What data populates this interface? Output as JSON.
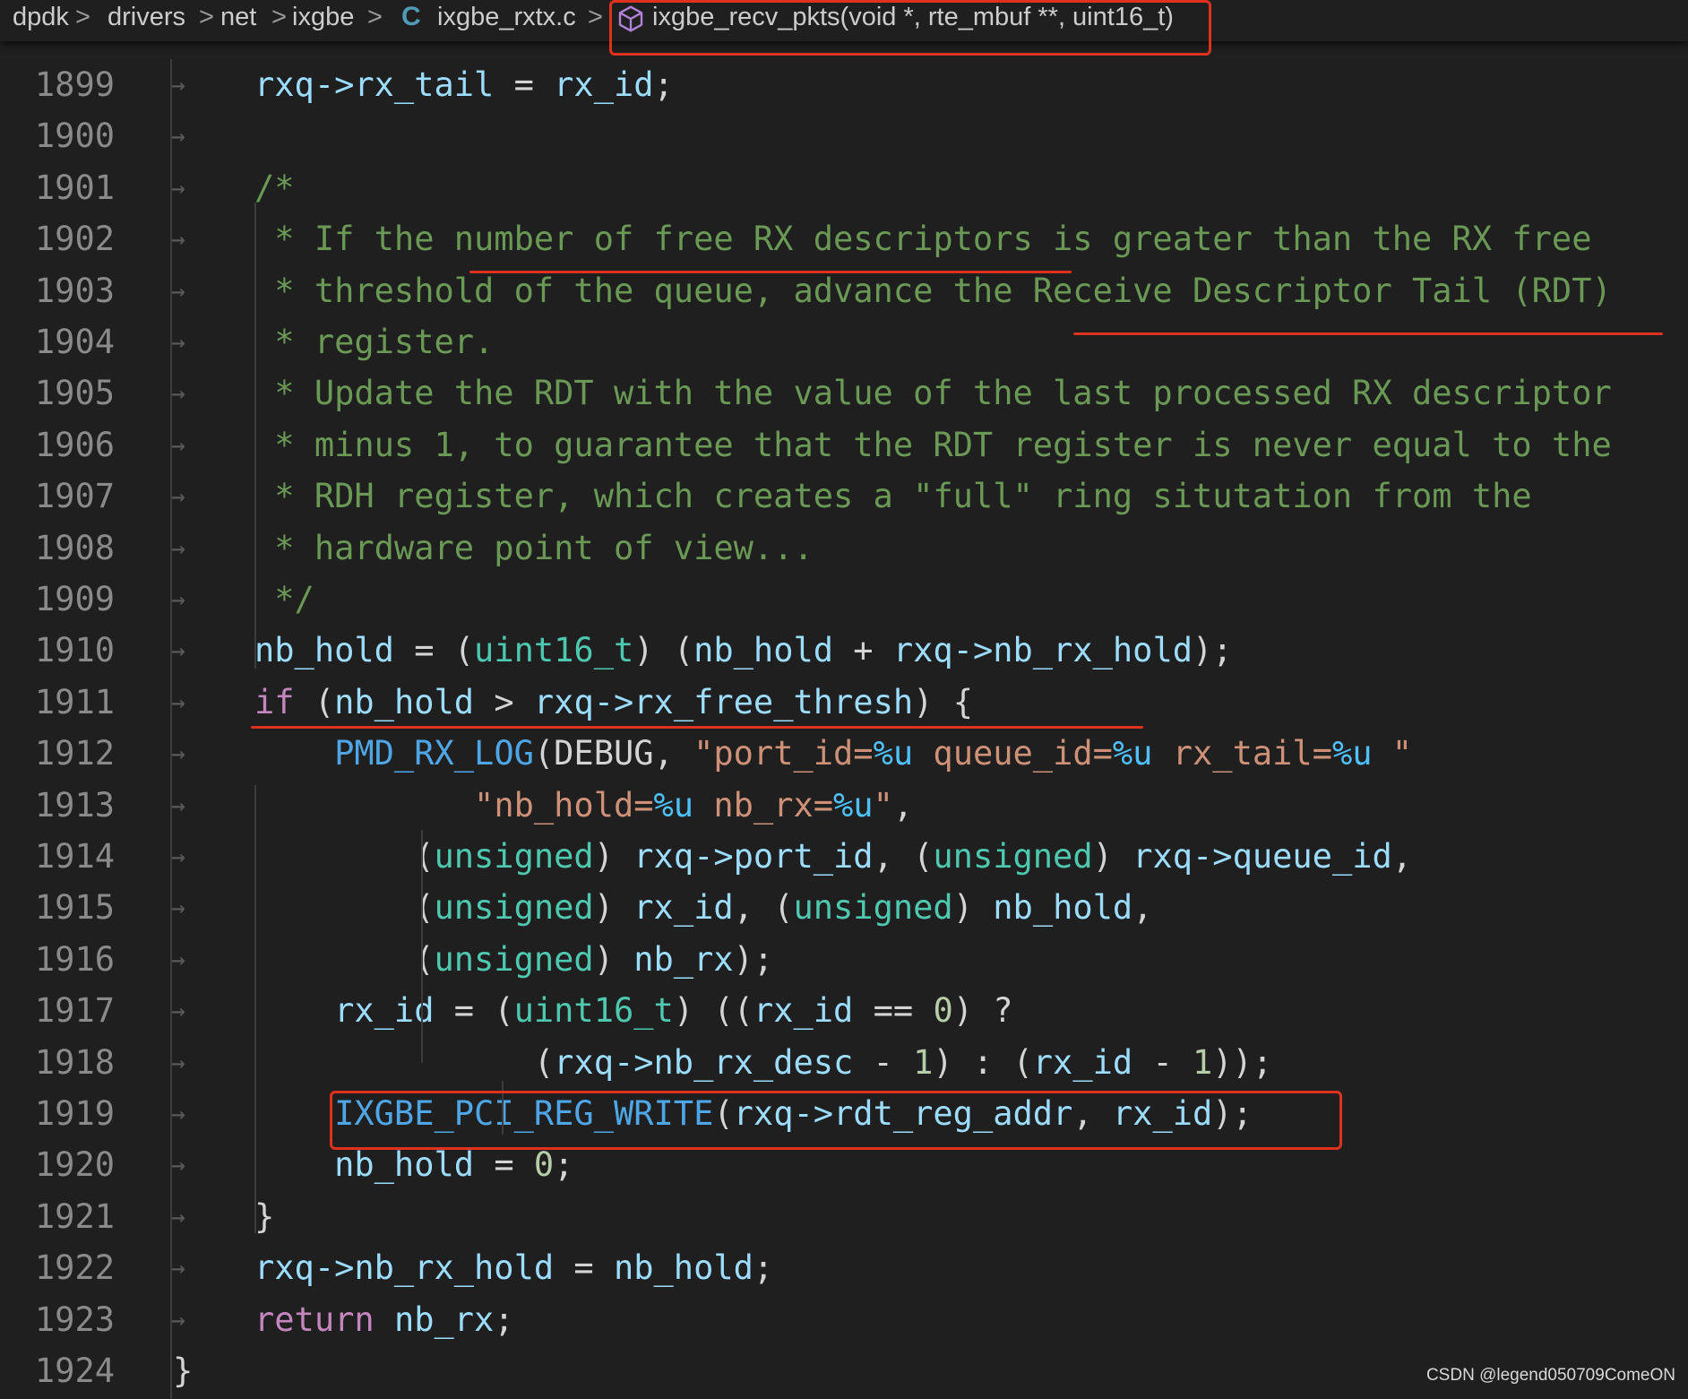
{
  "breadcrumb": {
    "items": [
      "dpdk",
      "drivers",
      "net",
      "ixgbe",
      "ixgbe_rxtx.c",
      "ixgbe_recv_pkts(void *, rte_mbuf **, uint16_t)"
    ],
    "file_icon": "C",
    "function_icon": "cube-icon",
    "separator": ">"
  },
  "editor": {
    "lines": [
      {
        "n": "1899",
        "segs": [
          [
            "vr",
            "rxq->rx_tail"
          ],
          [
            "pu",
            " = "
          ],
          [
            "vr",
            "rx_id"
          ],
          [
            "pu",
            ";"
          ]
        ]
      },
      {
        "n": "1900",
        "segs": []
      },
      {
        "n": "1901",
        "segs": [
          [
            "cm",
            "/*"
          ]
        ]
      },
      {
        "n": "1902",
        "segs": [
          [
            "cm",
            " * If the number of free RX descriptors is greater than the RX free"
          ]
        ]
      },
      {
        "n": "1903",
        "segs": [
          [
            "cm",
            " * threshold of the queue, advance the Receive Descriptor Tail (RDT)"
          ]
        ]
      },
      {
        "n": "1904",
        "segs": [
          [
            "cm",
            " * register."
          ]
        ]
      },
      {
        "n": "1905",
        "segs": [
          [
            "cm",
            " * Update the RDT with the value of the last processed RX descriptor"
          ]
        ]
      },
      {
        "n": "1906",
        "segs": [
          [
            "cm",
            " * minus 1, to guarantee that the RDT register is never equal to the"
          ]
        ]
      },
      {
        "n": "1907",
        "segs": [
          [
            "cm",
            " * RDH register, which creates a \"full\" ring situtation from the"
          ]
        ]
      },
      {
        "n": "1908",
        "segs": [
          [
            "cm",
            " * hardware point of view..."
          ]
        ]
      },
      {
        "n": "1909",
        "segs": [
          [
            "cm",
            " */"
          ]
        ]
      },
      {
        "n": "1910",
        "segs": [
          [
            "vr",
            "nb_hold"
          ],
          [
            "pu",
            " = ("
          ],
          [
            "ty",
            "uint16_t"
          ],
          [
            "pu",
            ") ("
          ],
          [
            "vr",
            "nb_hold"
          ],
          [
            "pu",
            " + "
          ],
          [
            "vr",
            "rxq->nb_rx_hold"
          ],
          [
            "pu",
            ");"
          ]
        ]
      },
      {
        "n": "1911",
        "segs": [
          [
            "kw",
            "if"
          ],
          [
            "pu",
            " ("
          ],
          [
            "vr",
            "nb_hold"
          ],
          [
            "pu",
            " > "
          ],
          [
            "vr",
            "rxq->rx_free_thresh"
          ],
          [
            "pu",
            ") {"
          ]
        ]
      },
      {
        "n": "1912",
        "segs": [
          [
            "pu",
            "    "
          ],
          [
            "fn",
            "PMD_RX_LOG"
          ],
          [
            "pu",
            "(DEBUG, "
          ],
          [
            "st",
            "\"port_id="
          ],
          [
            "mc",
            "%u"
          ],
          [
            "st",
            " queue_id="
          ],
          [
            "mc",
            "%u"
          ],
          [
            "st",
            " rx_tail="
          ],
          [
            "mc",
            "%u"
          ],
          [
            "st",
            " \""
          ]
        ]
      },
      {
        "n": "1913",
        "segs": [
          [
            "pu",
            "           "
          ],
          [
            "st",
            "\"nb_hold="
          ],
          [
            "mc",
            "%u"
          ],
          [
            "st",
            " nb_rx="
          ],
          [
            "mc",
            "%u"
          ],
          [
            "st",
            "\""
          ],
          [
            "pu",
            ","
          ]
        ]
      },
      {
        "n": "1914",
        "segs": [
          [
            "pu",
            "        ("
          ],
          [
            "ty",
            "unsigned"
          ],
          [
            "pu",
            ") "
          ],
          [
            "vr",
            "rxq->port_id"
          ],
          [
            "pu",
            ", ("
          ],
          [
            "ty",
            "unsigned"
          ],
          [
            "pu",
            ") "
          ],
          [
            "vr",
            "rxq->queue_id"
          ],
          [
            "pu",
            ","
          ]
        ]
      },
      {
        "n": "1915",
        "segs": [
          [
            "pu",
            "        ("
          ],
          [
            "ty",
            "unsigned"
          ],
          [
            "pu",
            ") "
          ],
          [
            "vr",
            "rx_id"
          ],
          [
            "pu",
            ", ("
          ],
          [
            "ty",
            "unsigned"
          ],
          [
            "pu",
            ") "
          ],
          [
            "vr",
            "nb_hold"
          ],
          [
            "pu",
            ","
          ]
        ]
      },
      {
        "n": "1916",
        "segs": [
          [
            "pu",
            "        ("
          ],
          [
            "ty",
            "unsigned"
          ],
          [
            "pu",
            ") "
          ],
          [
            "vr",
            "nb_rx"
          ],
          [
            "pu",
            ");"
          ]
        ]
      },
      {
        "n": "1917",
        "segs": [
          [
            "pu",
            "    "
          ],
          [
            "vr",
            "rx_id"
          ],
          [
            "pu",
            " = ("
          ],
          [
            "ty",
            "uint16_t"
          ],
          [
            "pu",
            ") (("
          ],
          [
            "vr",
            "rx_id"
          ],
          [
            "pu",
            " == "
          ],
          [
            "nm",
            "0"
          ],
          [
            "pu",
            ") ?"
          ]
        ]
      },
      {
        "n": "1918",
        "segs": [
          [
            "pu",
            "              ("
          ],
          [
            "vr",
            "rxq->nb_rx_desc"
          ],
          [
            "pu",
            " - "
          ],
          [
            "nm",
            "1"
          ],
          [
            "pu",
            ") : ("
          ],
          [
            "vr",
            "rx_id"
          ],
          [
            "pu",
            " - "
          ],
          [
            "nm",
            "1"
          ],
          [
            "pu",
            "));"
          ]
        ]
      },
      {
        "n": "1919",
        "segs": [
          [
            "pu",
            "    "
          ],
          [
            "fn",
            "IXGBE_PCI_REG_WRITE"
          ],
          [
            "pu",
            "("
          ],
          [
            "vr",
            "rxq->rdt_reg_addr"
          ],
          [
            "pu",
            ", "
          ],
          [
            "vr",
            "rx_id"
          ],
          [
            "pu",
            ");"
          ]
        ]
      },
      {
        "n": "1920",
        "segs": [
          [
            "pu",
            "    "
          ],
          [
            "vr",
            "nb_hold"
          ],
          [
            "pu",
            " = "
          ],
          [
            "nm",
            "0"
          ],
          [
            "pu",
            ";"
          ]
        ]
      },
      {
        "n": "1921",
        "segs": [
          [
            "pu",
            "}"
          ]
        ]
      },
      {
        "n": "1922",
        "segs": [
          [
            "vr",
            "rxq->nb_rx_hold"
          ],
          [
            "pu",
            " = "
          ],
          [
            "vr",
            "nb_hold"
          ],
          [
            "pu",
            ";"
          ]
        ]
      },
      {
        "n": "1923",
        "segs": [
          [
            "kw",
            "return"
          ],
          [
            "pu",
            " "
          ],
          [
            "vr",
            "nb_rx"
          ],
          [
            "pu",
            ";"
          ]
        ]
      },
      {
        "n": "1924",
        "segs": [
          [
            "pu",
            "}"
          ]
        ],
        "outdent": true
      }
    ]
  },
  "colors": {
    "annotation_red": "#e0301e",
    "comment": "#6a9955",
    "keyword": "#c586c0",
    "type": "#4ec9b0",
    "function": "#4fa6e6",
    "string": "#ce9178",
    "number": "#b5cea8",
    "variable": "#9cdcfe",
    "background": "#1f1f1f"
  },
  "watermark": "CSDN @legend050709ComeON"
}
